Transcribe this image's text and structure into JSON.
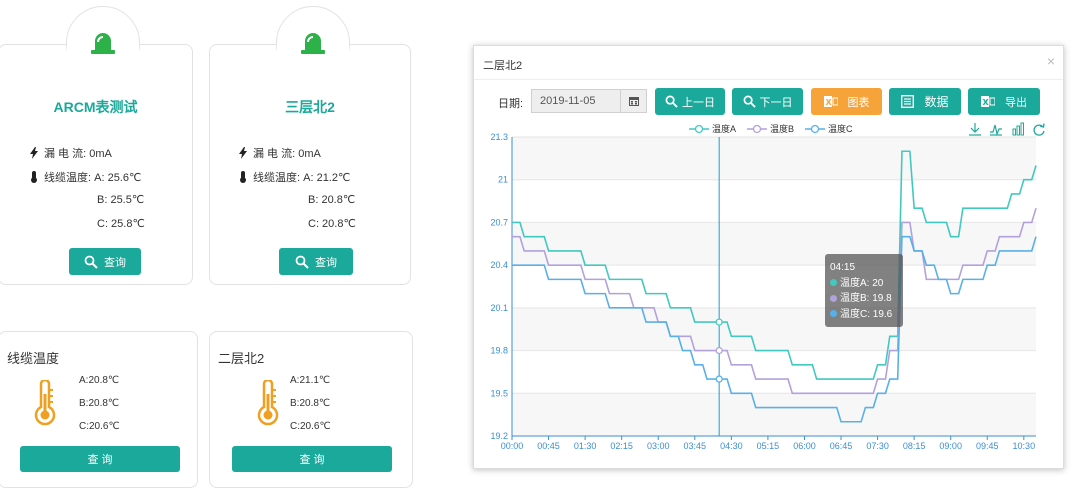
{
  "devices": [
    {
      "title": "ARCM表测试",
      "leak_label": "漏 电 流:",
      "leak_value": "0mA",
      "temp_label": "线缆温度:",
      "temp_a": "A: 25.6℃",
      "temp_b": "B: 25.5℃",
      "temp_c": "C: 25.8℃",
      "query_label": "查询"
    },
    {
      "title": "三层北2",
      "leak_label": "漏 电 流:",
      "leak_value": "0mA",
      "temp_label": "线缆温度:",
      "temp_a": "A: 21.2℃",
      "temp_b": "B: 20.8℃",
      "temp_c": "C: 20.8℃",
      "query_label": "查询"
    }
  ],
  "temp_cards": [
    {
      "title": "线缆温度",
      "a": "A:20.8℃",
      "b": "B:20.8℃",
      "c": "C:20.6℃",
      "query_label": "查 询"
    },
    {
      "title": "二层北2",
      "a": "A:21.1℃",
      "b": "B:20.8℃",
      "c": "C:20.6℃",
      "query_label": "查 询"
    }
  ],
  "modal": {
    "title": "二层北2",
    "close": "×",
    "date_label": "日期:",
    "date_value": "2019-11-05",
    "prev_label": "上一日",
    "next_label": "下一日",
    "chart_label": "图表",
    "data_label": "数据",
    "export_label": "导出"
  },
  "colors": {
    "accent": "#1aa99a",
    "orange": "#f6a43a",
    "seriesA": "#41c9c0",
    "seriesB": "#b3a1dc",
    "seriesC": "#59b0e8",
    "icon_green": "#2db24a",
    "thermo": "#f0a020"
  },
  "icons": [
    "alarm-light-icon",
    "lightning-icon",
    "thermometer-icon",
    "search-icon",
    "calendar-icon",
    "excel-icon",
    "list-icon",
    "download-icon",
    "line-chart-icon",
    "bar-chart-icon",
    "refresh-icon"
  ],
  "tooltip": {
    "time": "04:15",
    "a": "温度A: 20",
    "b": "温度B: 19.8",
    "c": "温度C: 19.6"
  },
  "chart_data": {
    "type": "line",
    "x": [
      "00:00",
      "00:15",
      "00:30",
      "00:45",
      "01:00",
      "01:15",
      "01:30",
      "01:45",
      "02:00",
      "02:15",
      "02:30",
      "02:45",
      "03:00",
      "03:15",
      "03:30",
      "03:45",
      "04:00",
      "04:15",
      "04:30",
      "04:45",
      "05:00",
      "05:15",
      "05:30",
      "05:45",
      "06:00",
      "06:15",
      "06:30",
      "06:45",
      "07:00",
      "07:15",
      "07:30",
      "07:45",
      "08:00",
      "08:15",
      "08:30",
      "08:45",
      "09:00",
      "09:15",
      "09:30",
      "09:45",
      "10:00",
      "10:15",
      "10:30",
      "10:45"
    ],
    "xticks": [
      "00:00",
      "00:45",
      "01:30",
      "02:15",
      "03:00",
      "03:45",
      "04:30",
      "05:15",
      "06:00",
      "06:45",
      "07:30",
      "08:15",
      "09:00",
      "09:45",
      "10:30"
    ],
    "yticks": [
      "19.2",
      "19.5",
      "19.8",
      "20.1",
      "20.4",
      "20.7",
      "21",
      "21.3"
    ],
    "ylim": [
      19.2,
      21.3
    ],
    "series": [
      {
        "name": "温度A",
        "values": [
          20.7,
          20.6,
          20.6,
          20.5,
          20.5,
          20.5,
          20.4,
          20.4,
          20.3,
          20.3,
          20.3,
          20.2,
          20.2,
          20.1,
          20.1,
          20.0,
          20.0,
          20.0,
          19.9,
          19.9,
          19.8,
          19.8,
          19.8,
          19.7,
          19.7,
          19.6,
          19.6,
          19.6,
          19.6,
          19.6,
          19.7,
          19.9,
          21.2,
          20.8,
          20.7,
          20.7,
          20.6,
          20.8,
          20.8,
          20.8,
          20.8,
          20.9,
          21.0,
          21.1
        ]
      },
      {
        "name": "温度B",
        "values": [
          20.6,
          20.5,
          20.5,
          20.4,
          20.4,
          20.4,
          20.3,
          20.3,
          20.2,
          20.2,
          20.1,
          20.1,
          20.0,
          19.9,
          19.9,
          19.8,
          19.8,
          19.8,
          19.7,
          19.7,
          19.6,
          19.6,
          19.6,
          19.5,
          19.5,
          19.5,
          19.5,
          19.5,
          19.5,
          19.5,
          19.6,
          19.8,
          20.7,
          20.5,
          20.3,
          20.3,
          20.3,
          20.4,
          20.4,
          20.5,
          20.6,
          20.6,
          20.7,
          20.8
        ]
      },
      {
        "name": "温度C",
        "values": [
          20.4,
          20.4,
          20.4,
          20.3,
          20.3,
          20.3,
          20.2,
          20.2,
          20.1,
          20.1,
          20.1,
          20.0,
          20.0,
          19.9,
          19.8,
          19.7,
          19.6,
          19.6,
          19.5,
          19.5,
          19.4,
          19.4,
          19.4,
          19.4,
          19.4,
          19.4,
          19.4,
          19.3,
          19.3,
          19.4,
          19.5,
          19.6,
          20.6,
          20.5,
          20.4,
          20.3,
          20.2,
          20.3,
          20.3,
          20.4,
          20.5,
          20.5,
          20.5,
          20.6
        ]
      }
    ],
    "legend_position": "top-center",
    "grid": true,
    "cursor_index": 17
  }
}
